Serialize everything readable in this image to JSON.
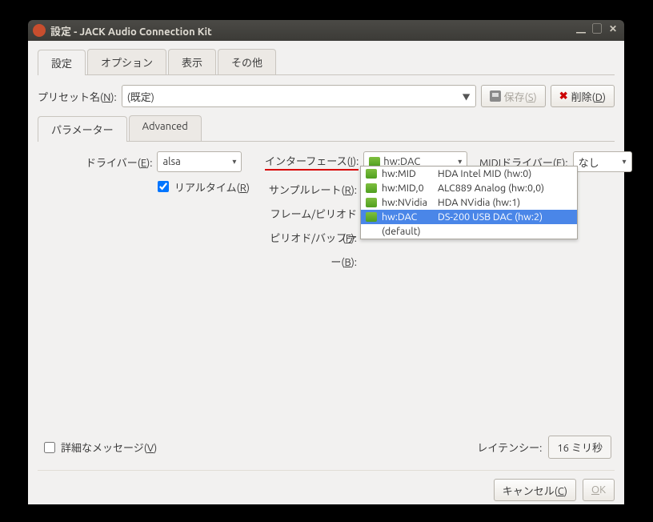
{
  "window": {
    "title": "設定 - JACK Audio Connection Kit"
  },
  "tabs": {
    "settings": "設定",
    "options": "オプション",
    "display": "表示",
    "misc": "その他"
  },
  "preset": {
    "label_pre": "プリセット名(",
    "label_u": "N",
    "label_post": "):",
    "value": "(既定)",
    "save_pre": "保存(",
    "save_u": "S",
    "save_post": ")",
    "delete_pre": "削除(",
    "delete_u": "D",
    "delete_post": ")"
  },
  "inner_tabs": {
    "parameters": "パラメーター",
    "advanced": "Advanced"
  },
  "form": {
    "driver_pre": "ドライバー(",
    "driver_u": "E",
    "driver_post": "):",
    "driver_value": "alsa",
    "realtime_pre": "リアルタイム(",
    "realtime_u": "R",
    "realtime_post": ")",
    "interface_pre": "インターフェース(",
    "interface_u": "I",
    "interface_post": "):",
    "interface_value": "hw:DAC",
    "samplerate_pre": "サンプルレート(",
    "samplerate_u": "R",
    "samplerate_post": "):",
    "frames_pre": "フレーム/ピリオド(",
    "frames_u": "F",
    "frames_post": "):",
    "periods_pre": "ピリオド/バッファー(",
    "periods_u": "B",
    "periods_post": "):",
    "midi_pre": "MIDIドライバー(",
    "midi_u": "E",
    "midi_post": "):",
    "midi_value": "なし"
  },
  "dropdown": {
    "items": [
      {
        "code": "hw:MID",
        "desc": "HDA Intel MID (hw:0)"
      },
      {
        "code": "hw:MID,0",
        "desc": "ALC889 Analog (hw:0,0)"
      },
      {
        "code": "hw:NVidia",
        "desc": "HDA NVidia (hw:1)"
      },
      {
        "code": "hw:DAC",
        "desc": "DS-200 USB DAC (hw:2)"
      }
    ],
    "default": "(default)"
  },
  "bottom": {
    "verbose_pre": "詳細なメッセージ(",
    "verbose_u": "V",
    "verbose_post": ")",
    "latency_label": "レイテンシー:",
    "latency_value": "16 ミリ秒"
  },
  "dialog": {
    "cancel_pre": "キャンセル(",
    "cancel_u": "C",
    "cancel_post": ")",
    "ok_u": "O",
    "ok_post": "K"
  }
}
